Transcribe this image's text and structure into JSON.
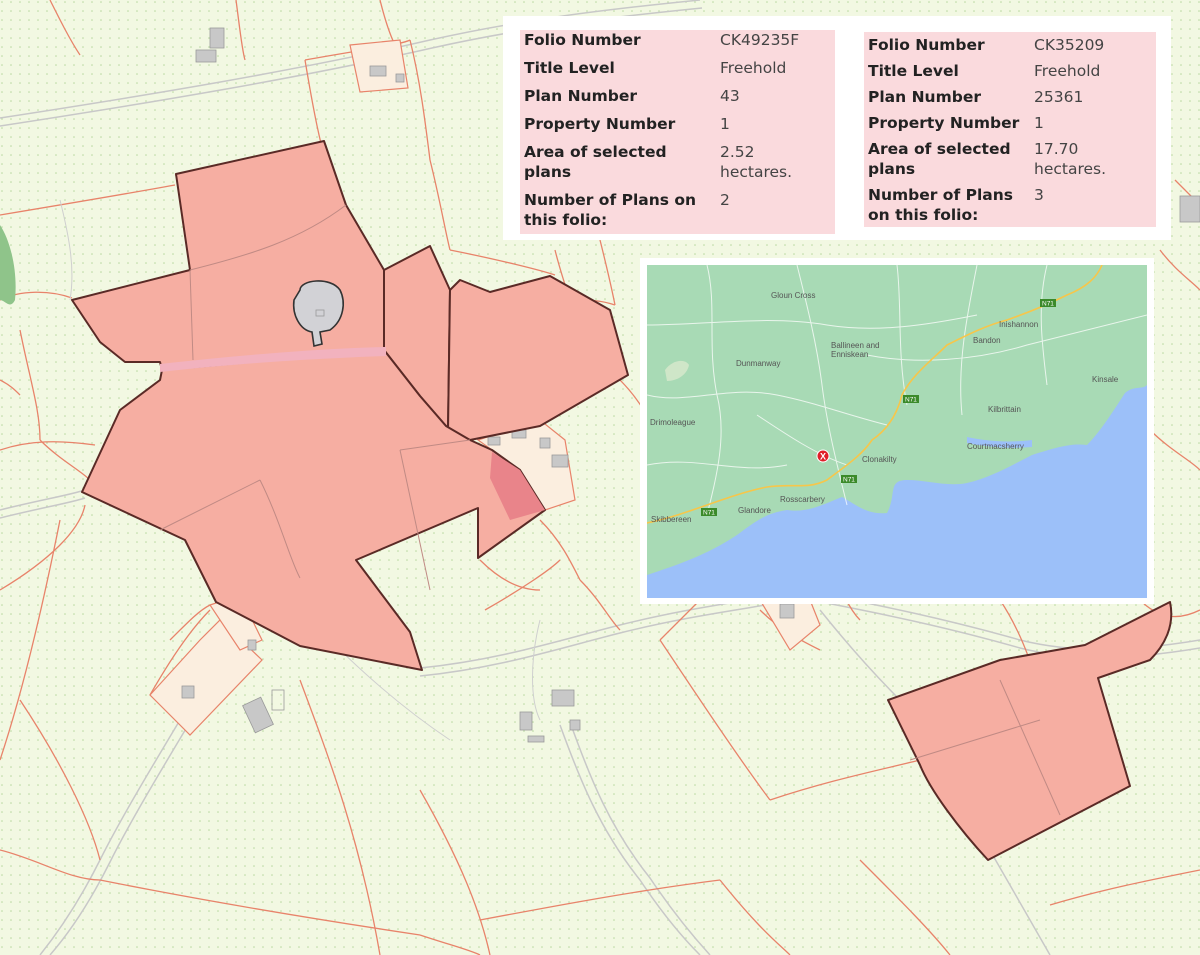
{
  "folios": [
    {
      "rows": [
        {
          "label": "Folio Number",
          "value": "CK49235F"
        },
        {
          "label": "Title Level",
          "value": "Freehold"
        },
        {
          "label": "Plan Number",
          "value": "43"
        },
        {
          "label": "Property Number",
          "value": "1"
        },
        {
          "label": "Area of selected plans",
          "value": "2.52 hectares."
        },
        {
          "label": "Number of Plans on this folio:",
          "value": "2"
        }
      ]
    },
    {
      "rows": [
        {
          "label": "Folio Number",
          "value": "CK35209"
        },
        {
          "label": "Title Level",
          "value": "Freehold"
        },
        {
          "label": "Plan Number",
          "value": "25361"
        },
        {
          "label": "Property Number",
          "value": "1"
        },
        {
          "label": "Area of selected plans",
          "value": "17.70 hectares."
        },
        {
          "label": "Number of Plans on this folio:",
          "value": "3"
        }
      ]
    }
  ],
  "inset_map": {
    "places": [
      "Gloun Cross",
      "Ballineen and Enniskean",
      "Dunmanway",
      "Inishannon",
      "Bandon",
      "Kinsale",
      "Kilbrittain",
      "Drimoleague",
      "Courtmacsherry",
      "Clonakilty",
      "Rosscarbery",
      "Glandore",
      "Skibbereen"
    ],
    "road_label": "N71",
    "marker_label": "X"
  },
  "colors": {
    "land": "#f2f8e2",
    "boundary": "#e8836a",
    "parcel_fill": "#f6aea2",
    "parcel_outline": "#5a2a26",
    "sea": "#9cc0f9",
    "inset_land": "#a8dab5",
    "marker": "#e0202a"
  }
}
